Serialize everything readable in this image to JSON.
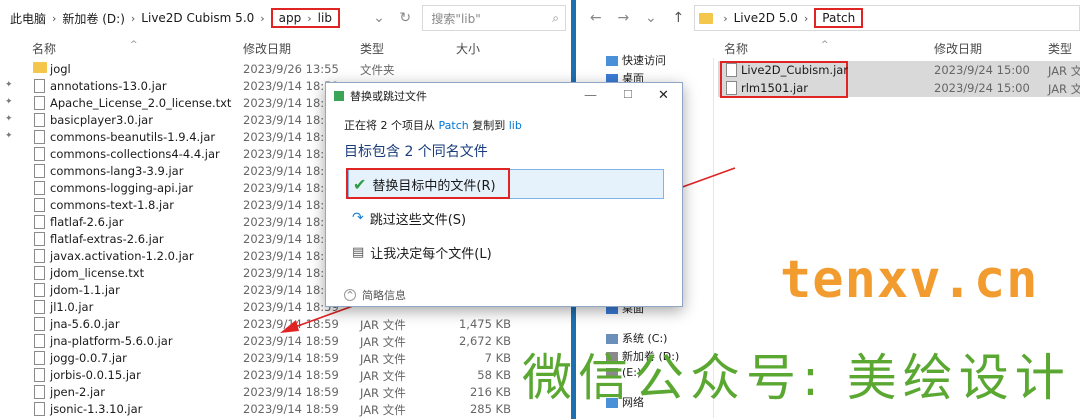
{
  "left": {
    "breadcrumb": [
      "此电脑",
      "新加卷 (D:)",
      "Live2D Cubism 5.0",
      "app",
      "lib"
    ],
    "search_placeholder": "搜索\"lib\"",
    "columns": {
      "name": "名称",
      "date": "修改日期",
      "type": "类型",
      "size": "大小"
    },
    "files": [
      {
        "name": "jogl",
        "date": "2023/9/26 13:55",
        "type": "文件夹",
        "size": "",
        "folder": true
      },
      {
        "name": "annotations-13.0.jar",
        "date": "2023/9/14 18:59",
        "type": "",
        "size": ""
      },
      {
        "name": "Apache_License_2.0_license.txt",
        "date": "2023/9/14 18:59",
        "type": "",
        "size": ""
      },
      {
        "name": "basicplayer3.0.jar",
        "date": "2023/9/14 18:59",
        "type": "",
        "size": ""
      },
      {
        "name": "commons-beanutils-1.9.4.jar",
        "date": "2023/9/14 18:59",
        "type": "",
        "size": ""
      },
      {
        "name": "commons-collections4-4.4.jar",
        "date": "2023/9/14 18:59",
        "type": "",
        "size": ""
      },
      {
        "name": "commons-lang3-3.9.jar",
        "date": "2023/9/14 18:59",
        "type": "",
        "size": ""
      },
      {
        "name": "commons-logging-api.jar",
        "date": "2023/9/14 18:59",
        "type": "",
        "size": ""
      },
      {
        "name": "commons-text-1.8.jar",
        "date": "2023/9/14 18:59",
        "type": "",
        "size": ""
      },
      {
        "name": "flatlaf-2.6.jar",
        "date": "2023/9/14 18:59",
        "type": "",
        "size": ""
      },
      {
        "name": "flatlaf-extras-2.6.jar",
        "date": "2023/9/14 18:59",
        "type": "",
        "size": ""
      },
      {
        "name": "javax.activation-1.2.0.jar",
        "date": "2023/9/14 18:59",
        "type": "",
        "size": ""
      },
      {
        "name": "jdom_license.txt",
        "date": "2023/9/14 18:59",
        "type": "",
        "size": ""
      },
      {
        "name": "jdom-1.1.jar",
        "date": "2023/9/14 18:59",
        "type": "",
        "size": ""
      },
      {
        "name": "jl1.0.jar",
        "date": "2023/9/14 18:59",
        "type": "",
        "size": ""
      },
      {
        "name": "jna-5.6.0.jar",
        "date": "2023/9/14 18:59",
        "type": "JAR 文件",
        "size": "1,475 KB"
      },
      {
        "name": "jna-platform-5.6.0.jar",
        "date": "2023/9/14 18:59",
        "type": "JAR 文件",
        "size": "2,672 KB"
      },
      {
        "name": "jogg-0.0.7.jar",
        "date": "2023/9/14 18:59",
        "type": "JAR 文件",
        "size": "7 KB"
      },
      {
        "name": "jorbis-0.0.15.jar",
        "date": "2023/9/14 18:59",
        "type": "JAR 文件",
        "size": "58 KB"
      },
      {
        "name": "jpen-2.jar",
        "date": "2023/9/14 18:59",
        "type": "JAR 文件",
        "size": "216 KB"
      },
      {
        "name": "jsonic-1.3.10.jar",
        "date": "2023/9/14 18:59",
        "type": "JAR 文件",
        "size": "285 KB"
      }
    ]
  },
  "right": {
    "breadcrumb": [
      "Live2D 5.0",
      "Patch"
    ],
    "columns": {
      "name": "名称",
      "date": "修改日期",
      "type": "类型"
    },
    "nav": [
      "快速访问",
      "桌面",
      "桌面",
      "系统 (C:)",
      "新加卷 (D:)",
      "(E:)",
      "网络"
    ],
    "files": [
      {
        "name": "Live2D_Cubism.jar",
        "date": "2023/9/24 15:00",
        "type": "JAR 文"
      },
      {
        "name": "rlm1501.jar",
        "date": "2023/9/24 15:00",
        "type": "JAR 文"
      }
    ]
  },
  "dialog": {
    "title": "替换或跳过文件",
    "info_prefix": "正在将 2 个项目从",
    "info_src": "Patch",
    "info_mid": "复制到",
    "info_dst": "lib",
    "heading": "目标包含 2 个同名文件",
    "opt_replace": "替换目标中的文件(R)",
    "opt_skip": "跳过这些文件(S)",
    "opt_decide": "让我决定每个文件(L)",
    "details": "简略信息"
  },
  "watermark": {
    "site": "tenxv.cn",
    "wechat": "微信公众号: 美绘设计"
  },
  "colors": {
    "highlight": "#e02424",
    "accent": "#0078d4"
  }
}
